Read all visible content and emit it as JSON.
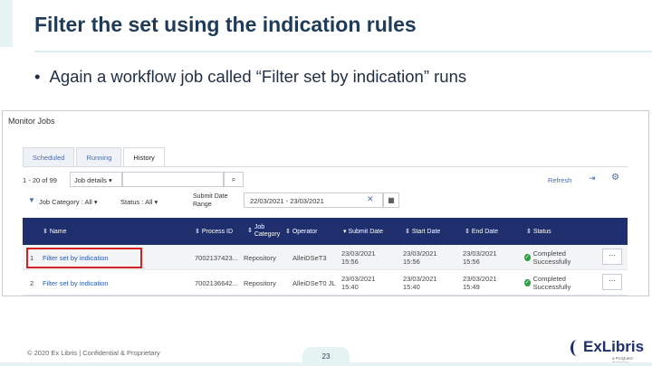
{
  "slide": {
    "title": "Filter the set using the indication rules",
    "bullet": "Again a workflow job called “Filter set by indication” runs",
    "bullet_dot": "•",
    "footer": "© 2020 Ex Libris | Confidential & Proprietary",
    "page_number": "23",
    "logo_text": "ExLibris",
    "logo_sub": "a ProQuest Company"
  },
  "app": {
    "title": "Monitor Jobs",
    "tabs": [
      {
        "label": "Scheduled",
        "active": false
      },
      {
        "label": "Running",
        "active": false
      },
      {
        "label": "History",
        "active": true
      }
    ],
    "toolbar": {
      "row_count": "1 - 20 of 99",
      "job_select": "Job details",
      "search_value": "",
      "refresh_label": "Refresh"
    },
    "filters": {
      "category": "Job Category : All",
      "status": "Status : All",
      "date_label": "Submit Date Range",
      "date_value": "22/03/2021 - 23/03/2021"
    },
    "table": {
      "headers": [
        "Name",
        "Process ID",
        "Job Category",
        "Operator",
        "Submit Date",
        "Start Date",
        "End Date",
        "Status"
      ],
      "rows": [
        {
          "num": "1",
          "name": "Filter set by indication",
          "process_id": "7002137423...",
          "category": "Repository",
          "operator": "AlleiDSeT3",
          "submit": "23/03/2021 15:56",
          "start": "23/03/2021 15:56",
          "end": "23/03/2021 15:56",
          "status": "Completed Successfully",
          "highlighted": true
        },
        {
          "num": "2",
          "name": "Filter set by indication",
          "process_id": "7002136642...",
          "category": "Repository",
          "operator": "AlleiDSeT0 JL",
          "submit": "23/03/2021 15:40",
          "start": "23/03/2021 15:40",
          "end": "23/03/2021 15:49",
          "status": "Completed Successfully",
          "highlighted": false
        }
      ]
    }
  },
  "colors": {
    "title": "#1f3b57",
    "header_bg": "#1f2f6e",
    "highlight": "#d32020",
    "link": "#2b5aa8",
    "success": "#2f9e44"
  }
}
